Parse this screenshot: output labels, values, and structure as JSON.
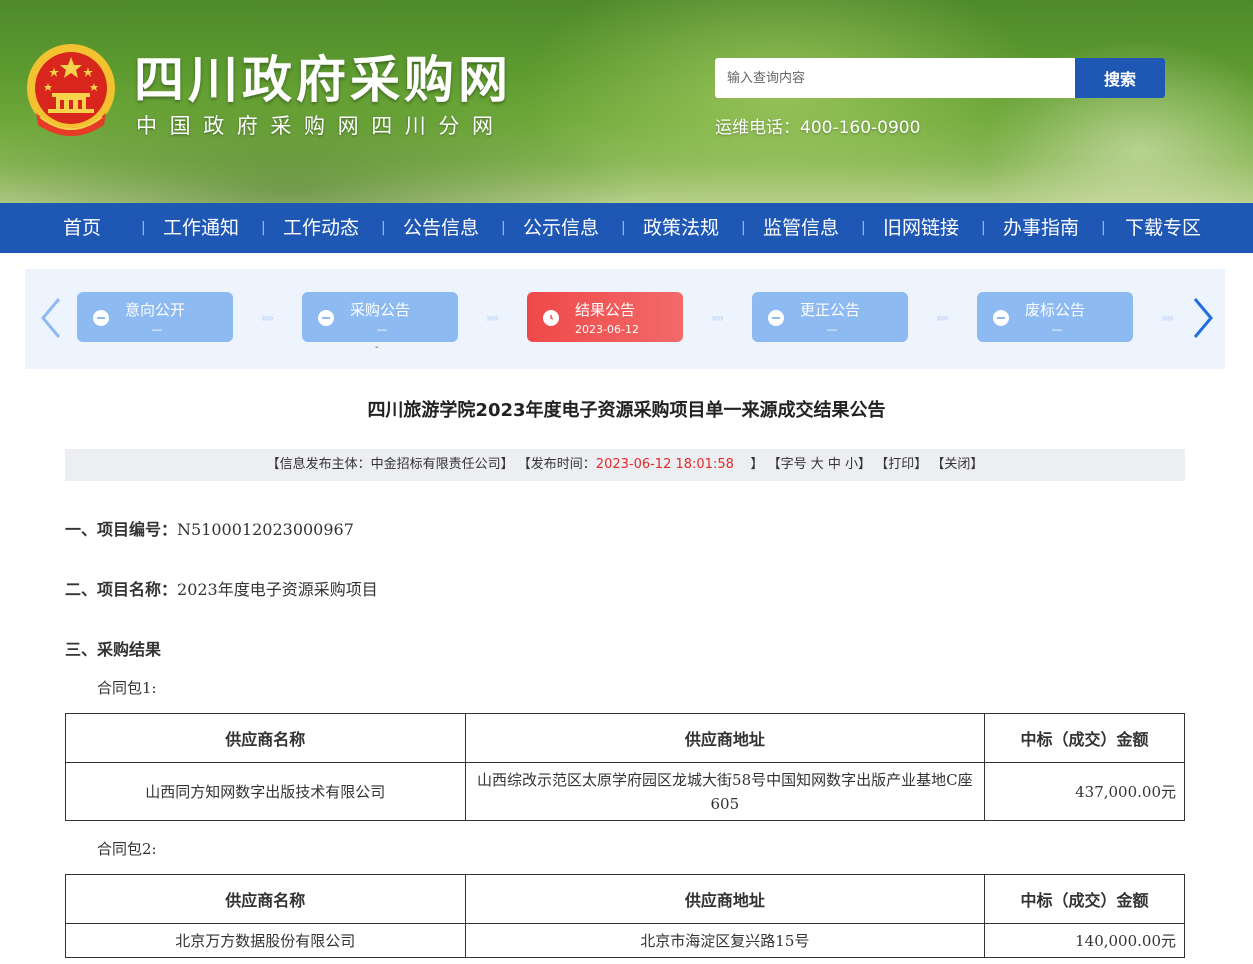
{
  "header": {
    "site_title": "四川政府采购网",
    "site_subtitle": "中国政府采购网四川分网",
    "search_placeholder": "输入查询内容",
    "search_button": "搜索",
    "hotline": "运维电话：400-160-0900",
    "emblem_icon": "national-emblem-icon"
  },
  "nav": {
    "items": [
      "首页",
      "工作通知",
      "工作动态",
      "公告信息",
      "公示信息",
      "政策法规",
      "监管信息",
      "旧网链接",
      "办事指南",
      "下载专区"
    ]
  },
  "steps": {
    "items": [
      {
        "label": "意向公开",
        "date": "—",
        "active": false
      },
      {
        "label": "采购公告",
        "date": "—",
        "active": false
      },
      {
        "label": "结果公告",
        "date": "2023-06-12",
        "active": true
      },
      {
        "label": "更正公告",
        "date": "—",
        "active": false
      },
      {
        "label": "废标公告",
        "date": "—",
        "active": false
      }
    ],
    "under_mark": "-",
    "colors": {
      "inactive": "#8ebaf2",
      "active": "#f04848"
    }
  },
  "article": {
    "title": "四川旅游学院2023年度电子资源采购项目单一来源成交结果公告",
    "meta": {
      "publisher": "【信息发布主体：中金招标有限责任公司】",
      "time_label": "【发布时间：",
      "time_value": "2023-06-12 18:01:58",
      "time_close": "】",
      "font_size": "【字号",
      "size_large": "大",
      "size_medium": "中",
      "size_small": "小",
      "font_close": "】",
      "print": "【打印】",
      "close": "【关闭】"
    },
    "section1_label": "一、项目编号：",
    "section1_value": "N5100012023000967",
    "section2_label": "二、项目名称：",
    "section2_value": "2023年度电子资源采购项目",
    "section3_label": "三、采购结果",
    "packages": [
      {
        "name": "合同包1:",
        "headers": [
          "供应商名称",
          "供应商地址",
          "中标（成交）金额"
        ],
        "rows": [
          [
            "山西同方知网数字出版技术有限公司",
            "山西综改示范区太原学府园区龙城大街58号中国知网数字出版产业基地C座605",
            "437,000.00元"
          ]
        ]
      },
      {
        "name": "合同包2:",
        "headers": [
          "供应商名称",
          "供应商地址",
          "中标（成交）金额"
        ],
        "rows": [
          [
            "北京万方数据股份有限公司",
            "北京市海淀区复兴路15号",
            "140,000.00元"
          ]
        ]
      }
    ]
  },
  "colors": {
    "nav_blue": "#1f57b5",
    "highlight_red": "#e02b2b"
  }
}
